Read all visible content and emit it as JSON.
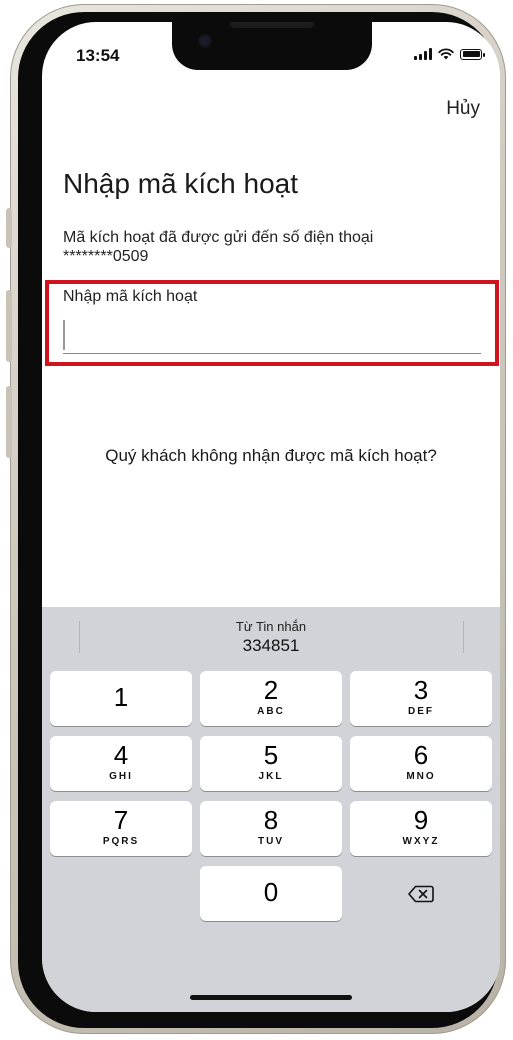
{
  "status_bar": {
    "time": "13:54"
  },
  "header": {
    "cancel_label": "Hủy"
  },
  "page": {
    "title": "Nhập mã kích hoạt",
    "sent_message": "Mã kích hoạt đã được gửi đến số điện thoại",
    "masked_phone": "********0509"
  },
  "code_field": {
    "label": "Nhập mã kích hoạt",
    "value": ""
  },
  "resend_prompt": "Quý khách không nhận được mã kích hoạt?",
  "keyboard": {
    "suggestion": {
      "source": "Từ Tin nhắn",
      "code": "334851"
    },
    "keys": [
      {
        "digit": "1",
        "letters": ""
      },
      {
        "digit": "2",
        "letters": "ABC"
      },
      {
        "digit": "3",
        "letters": "DEF"
      },
      {
        "digit": "4",
        "letters": "GHI"
      },
      {
        "digit": "5",
        "letters": "JKL"
      },
      {
        "digit": "6",
        "letters": "MNO"
      },
      {
        "digit": "7",
        "letters": "PQRS"
      },
      {
        "digit": "8",
        "letters": "TUV"
      },
      {
        "digit": "9",
        "letters": "WXYZ"
      },
      {
        "digit": "0",
        "letters": ""
      }
    ],
    "delete_icon": "backspace-icon"
  },
  "colors": {
    "highlight": "#d0141f",
    "keyboard_bg": "#d1d3d9"
  }
}
